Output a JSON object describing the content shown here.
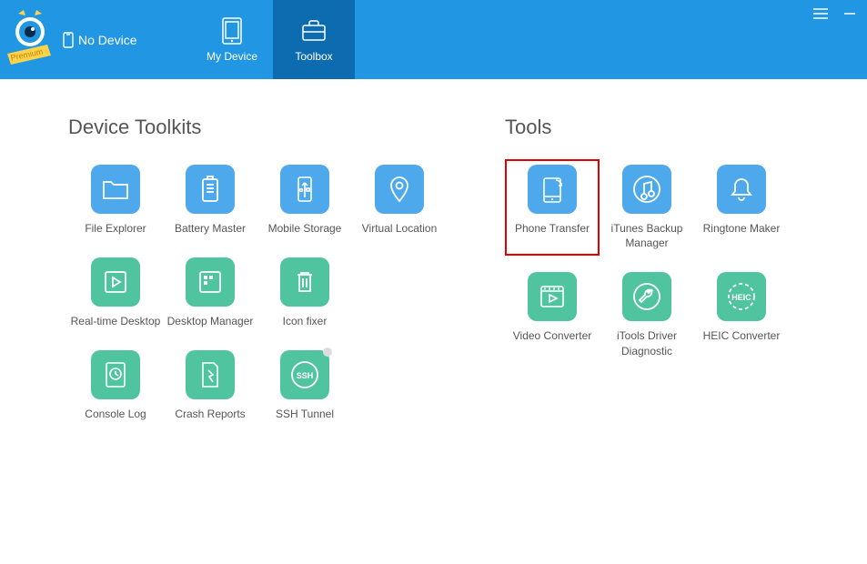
{
  "header": {
    "device_status": "No Device",
    "premium_label": "Premium",
    "tabs": {
      "my_device": "My Device",
      "toolbox": "Toolbox"
    }
  },
  "sections": {
    "toolkits_title": "Device Toolkits",
    "tools_title": "Tools"
  },
  "toolkits": [
    {
      "label": "File Explorer"
    },
    {
      "label": "Battery Master"
    },
    {
      "label": "Mobile Storage"
    },
    {
      "label": "Virtual Location"
    },
    {
      "label": "Real-time Desktop"
    },
    {
      "label": "Desktop Manager"
    },
    {
      "label": "Icon fixer"
    },
    {
      "label": "Console Log"
    },
    {
      "label": "Crash Reports"
    },
    {
      "label": "SSH Tunnel"
    }
  ],
  "tools": [
    {
      "label": "Phone Transfer"
    },
    {
      "label": "iTunes Backup Manager"
    },
    {
      "label": "Ringtone Maker"
    },
    {
      "label": "Video Converter"
    },
    {
      "label": "iTools Driver Diagnostic"
    },
    {
      "label": "HEIC Converter"
    }
  ],
  "icons": {
    "ssh_text": "SSH",
    "heic_text": "HEIC"
  }
}
